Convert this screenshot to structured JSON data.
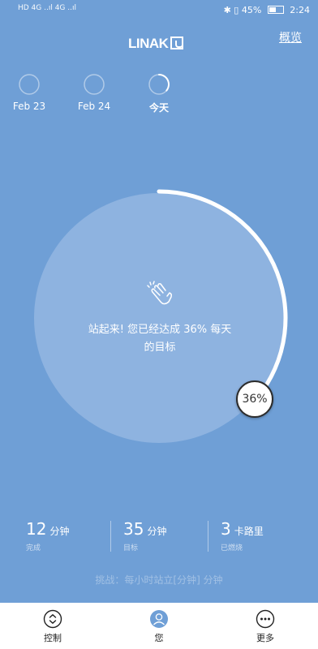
{
  "status": {
    "left_text": "HD 4G ..ıl 4G ..ıl",
    "battery": "45%",
    "time": "2:24"
  },
  "header": {
    "logo": "LINAK",
    "overview": "概览"
  },
  "days": [
    {
      "label": "Feb 23",
      "progress": 0
    },
    {
      "label": "Feb 24",
      "progress": 0
    },
    {
      "label": "今天",
      "progress": 0.36
    }
  ],
  "goal": {
    "progress_percent": 36,
    "message_line1": "站起来! 您已经达成 36% 每天",
    "message_line2": "的目标",
    "badge": "36%"
  },
  "stats": [
    {
      "value": "12",
      "unit": "分钟",
      "label": "完成"
    },
    {
      "value": "35",
      "unit": "分钟",
      "label": "目标"
    },
    {
      "value": "3",
      "unit": "卡路里",
      "label": "已燃烧"
    }
  ],
  "challenge": "挑战：每小时站立[分钟] 分钟",
  "tabs": [
    {
      "label": "控制",
      "icon": "chevron-updown-icon"
    },
    {
      "label": "您",
      "icon": "user-icon"
    },
    {
      "label": "更多",
      "icon": "more-icon"
    }
  ],
  "colors": {
    "background": "#6f9fd6",
    "disk": "#8eb3e0",
    "accent_blue": "#6f9fd6"
  }
}
